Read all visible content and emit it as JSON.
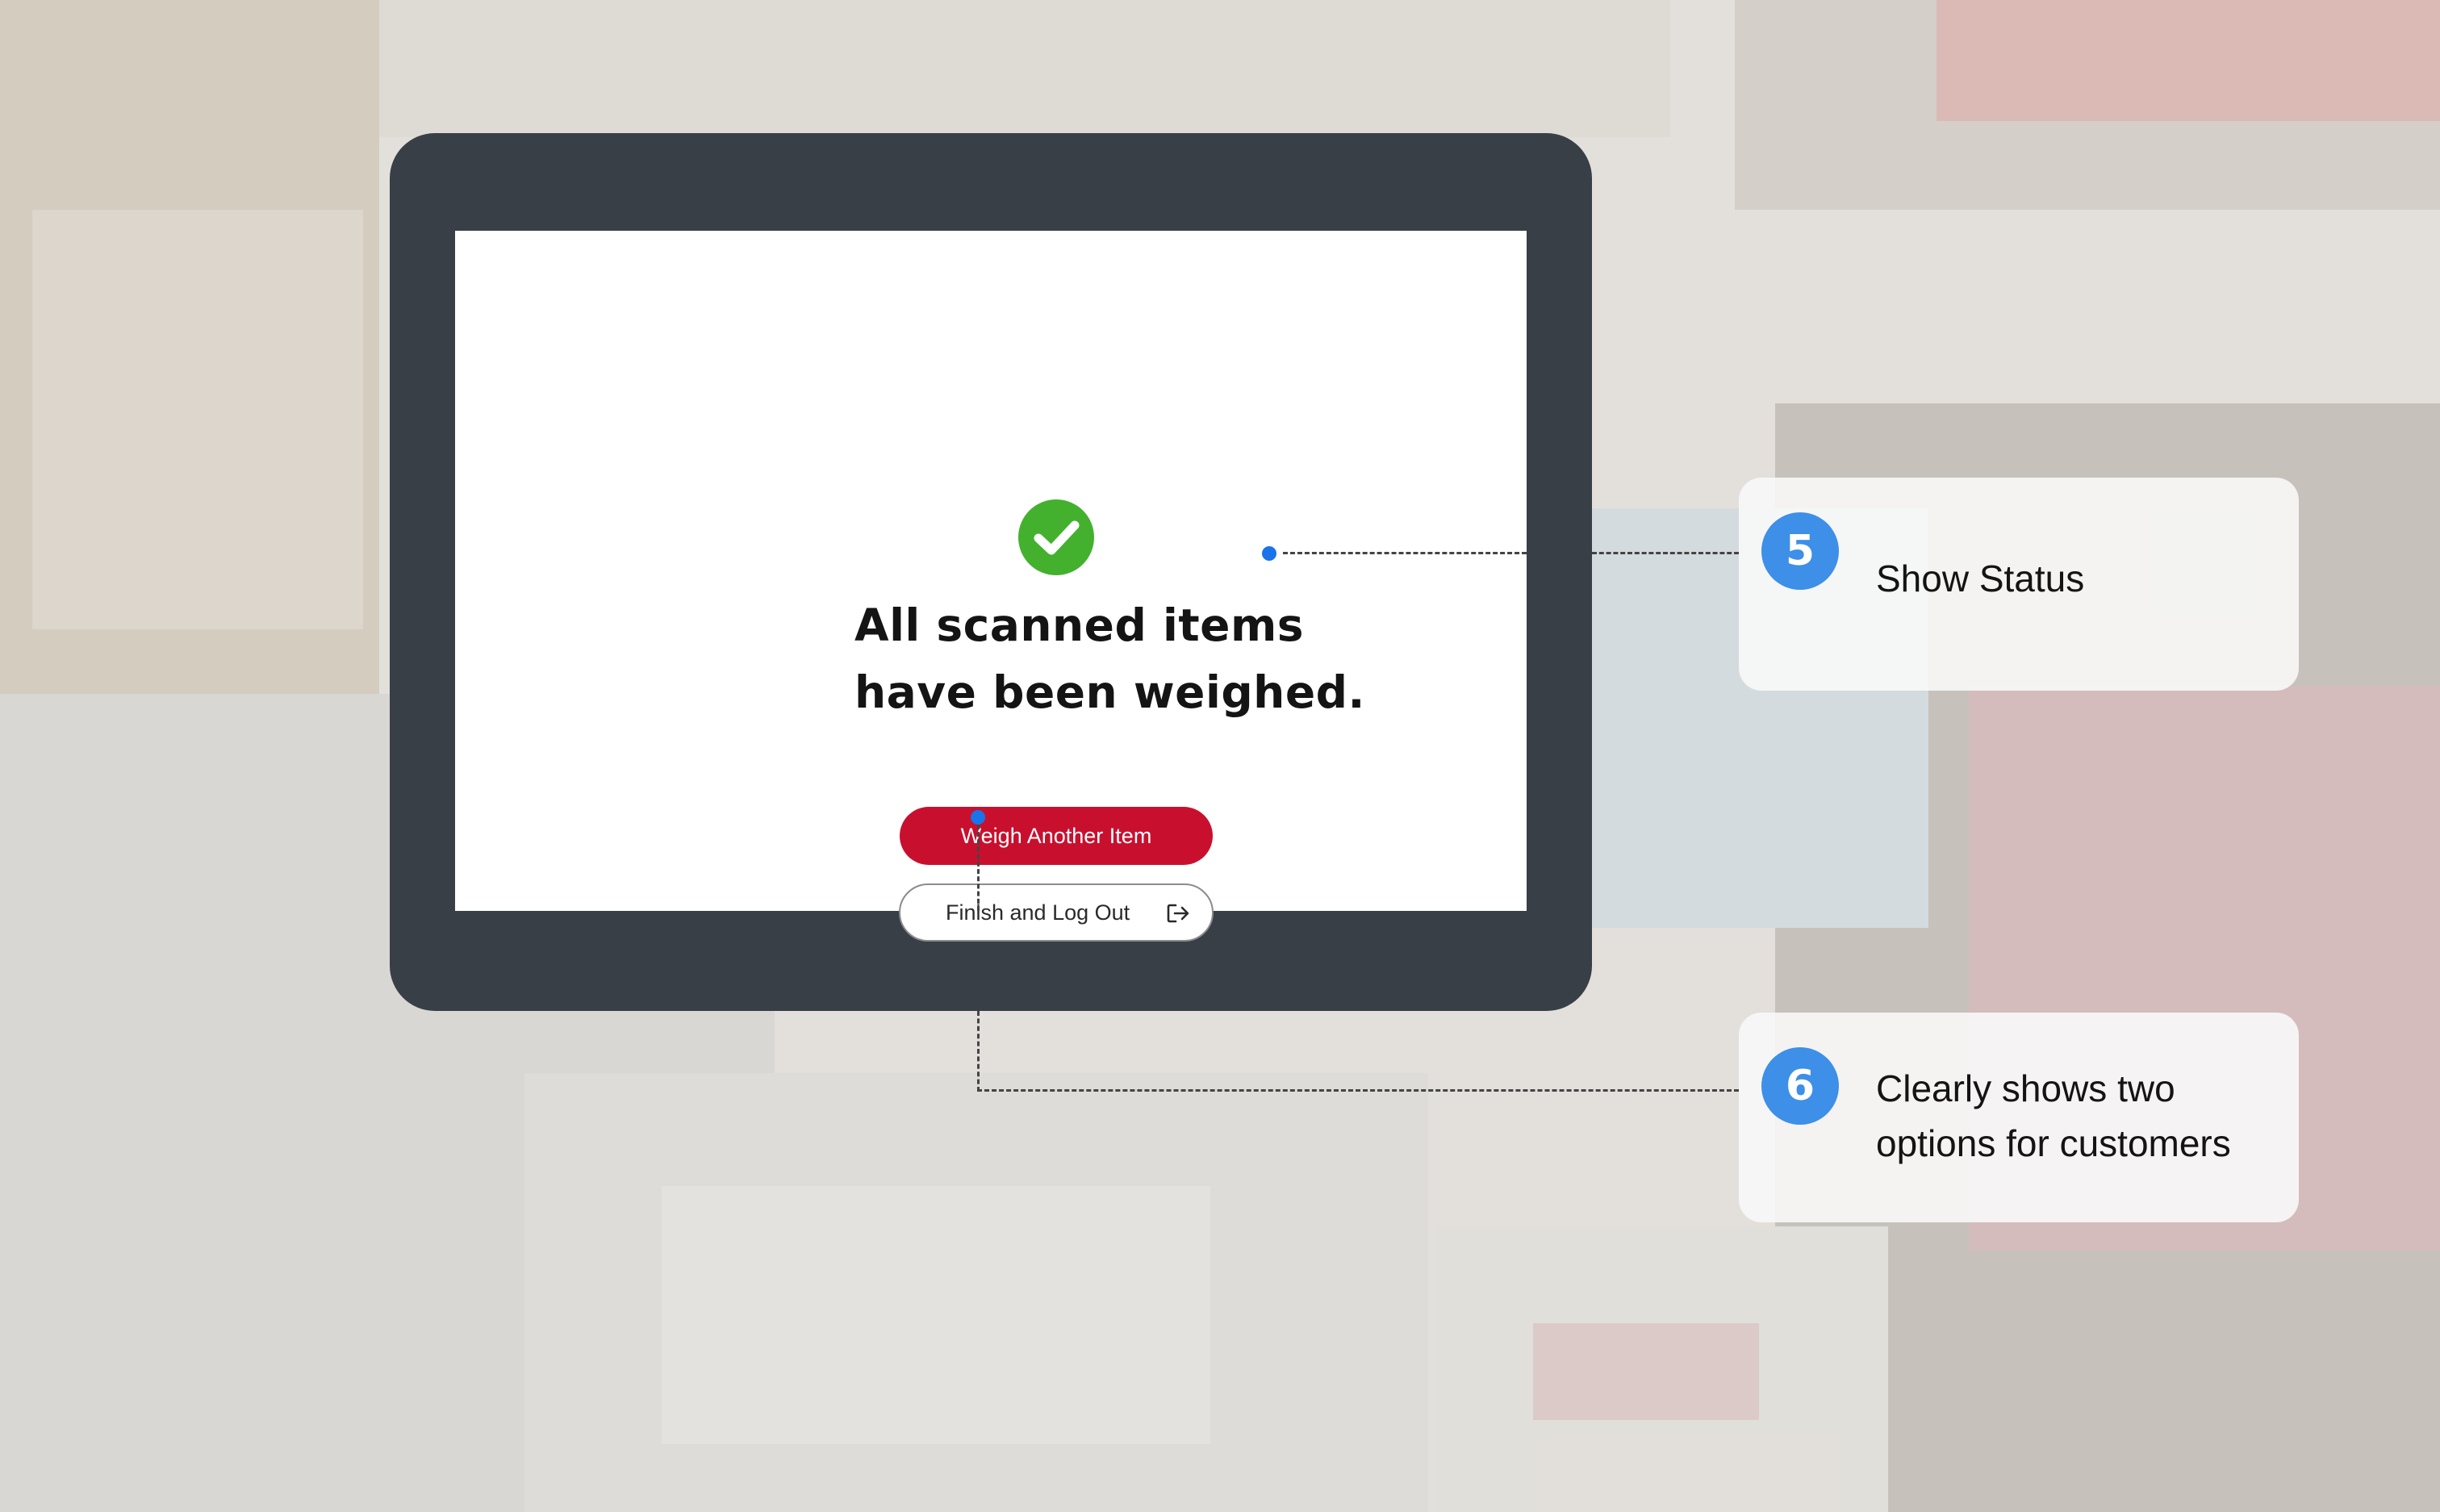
{
  "kiosk": {
    "status_lines": [
      "All scanned items",
      "have been weighed."
    ],
    "weigh_button": "Weigh Another Item",
    "finish_button": "Finish and Log Out",
    "icons": {
      "status": "check-circle-icon",
      "finish": "logout-icon"
    },
    "colors": {
      "check": "#43b12e",
      "primary": "#c8102e",
      "device": "#383f47"
    }
  },
  "annotations": [
    {
      "number": "5",
      "lines": [
        "Show Status"
      ]
    },
    {
      "number": "6",
      "lines": [
        "Clearly shows two",
        "options for customers"
      ]
    }
  ],
  "colors": {
    "annotation_badge": "#3d8fe8",
    "connector_dot": "#1a73e8"
  }
}
